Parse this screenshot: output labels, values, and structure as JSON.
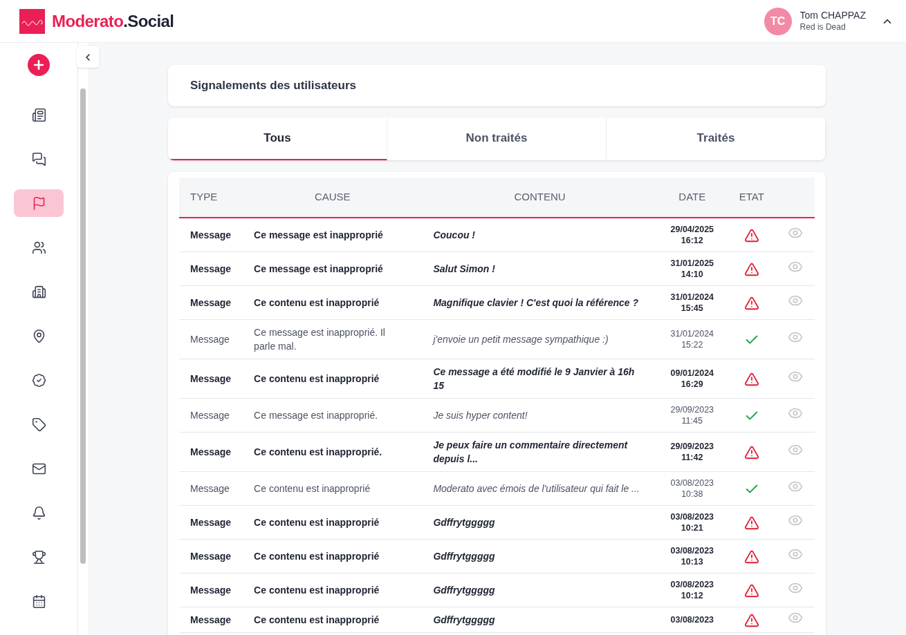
{
  "brand": {
    "name": "Moderato",
    "suffix": ".Social"
  },
  "user": {
    "initials": "TC",
    "name": "Tom CHAPPAZ",
    "subtitle": "Red is Dead"
  },
  "sidebar": {
    "items": [
      {
        "selected": false
      },
      {
        "selected": false
      },
      {
        "selected": true
      },
      {
        "selected": false
      },
      {
        "selected": false
      },
      {
        "selected": false
      },
      {
        "selected": false
      },
      {
        "selected": false
      },
      {
        "selected": false
      },
      {
        "selected": false
      },
      {
        "selected": false
      },
      {
        "selected": false
      }
    ]
  },
  "page_title": "Signalements des utilisateurs",
  "tabs": [
    {
      "label": "Tous",
      "selected": true
    },
    {
      "label": "Non traités",
      "selected": false
    },
    {
      "label": "Traités",
      "selected": false
    }
  ],
  "table": {
    "columns": [
      "TYPE",
      "CAUSE",
      "CONTENU",
      "DATE",
      "ETAT"
    ],
    "rows": [
      {
        "type": "Message",
        "cause": "Ce message est inapproprié",
        "content": "Coucou !",
        "date": "29/04/2025",
        "time": "16:12",
        "treated": false
      },
      {
        "type": "Message",
        "cause": "Ce message est inapproprié",
        "content": "Salut Simon !",
        "date": "31/01/2025",
        "time": "14:10",
        "treated": false
      },
      {
        "type": "Message",
        "cause": "Ce contenu est inapproprié",
        "content": "Magnifique clavier ! C'est quoi la référence ?",
        "date": "31/01/2024",
        "time": "15:45",
        "treated": false
      },
      {
        "type": "Message",
        "cause": "Ce message est inapproprié. Il parle mal.",
        "content": "j'envoie un petit message sympathique :)",
        "date": "31/01/2024",
        "time": "15:22",
        "treated": true
      },
      {
        "type": "Message",
        "cause": "Ce contenu est inapproprié",
        "content": "Ce message a été modifié le 9 Janvier à 16h 15",
        "date": "09/01/2024",
        "time": "16:29",
        "treated": false
      },
      {
        "type": "Message",
        "cause": "Ce message est inapproprié.",
        "content": "Je suis hyper content!",
        "date": "29/09/2023",
        "time": "11:45",
        "treated": true
      },
      {
        "type": "Message",
        "cause": "Ce contenu est inapproprié.",
        "content": "Je peux faire un commentaire directement depuis l...",
        "date": "29/09/2023",
        "time": "11:42",
        "treated": false
      },
      {
        "type": "Message",
        "cause": "Ce contenu est inapproprié",
        "content": "Moderato avec émois de l'utilisateur qui fait le ...",
        "date": "03/08/2023",
        "time": "10:38",
        "treated": true
      },
      {
        "type": "Message",
        "cause": "Ce contenu est inapproprié",
        "content": "Gdffrytggggg",
        "date": "03/08/2023",
        "time": "10:21",
        "treated": false
      },
      {
        "type": "Message",
        "cause": "Ce contenu est inapproprié",
        "content": "Gdffrytggggg",
        "date": "03/08/2023",
        "time": "10:13",
        "treated": false
      },
      {
        "type": "Message",
        "cause": "Ce contenu est inapproprié",
        "content": "Gdffrytggggg",
        "date": "03/08/2023",
        "time": "10:12",
        "treated": false
      },
      {
        "type": "Message",
        "cause": "Ce contenu est inapproprié",
        "content": "Gdffrytggggg",
        "date": "03/08/2023",
        "treated": false
      }
    ]
  }
}
